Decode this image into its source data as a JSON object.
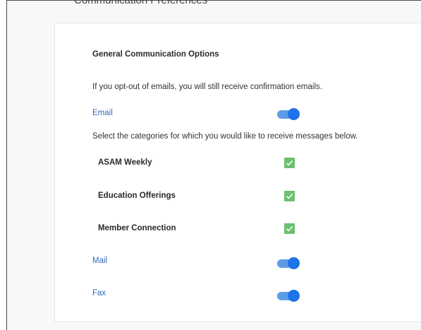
{
  "section_title": "Communication Preferences",
  "general": {
    "heading": "General Communication Options",
    "optout_note": "If you opt-out of emails, you will still receive confirmation emails."
  },
  "email": {
    "label": "Email",
    "enabled": true,
    "categories_note": "Select the categories for which you would like to receive messages below.",
    "categories": [
      {
        "label": "ASAM Weekly",
        "checked": true
      },
      {
        "label": "Education Offerings",
        "checked": true
      },
      {
        "label": "Member Connection",
        "checked": true
      }
    ]
  },
  "mail": {
    "label": "Mail",
    "enabled": true
  },
  "fax": {
    "label": "Fax",
    "enabled": true
  },
  "colors": {
    "toggle_track": "#5e9be6",
    "toggle_knob": "#1f73e8",
    "checkbox": "#6cc06f",
    "link_label": "#2f6db5"
  }
}
